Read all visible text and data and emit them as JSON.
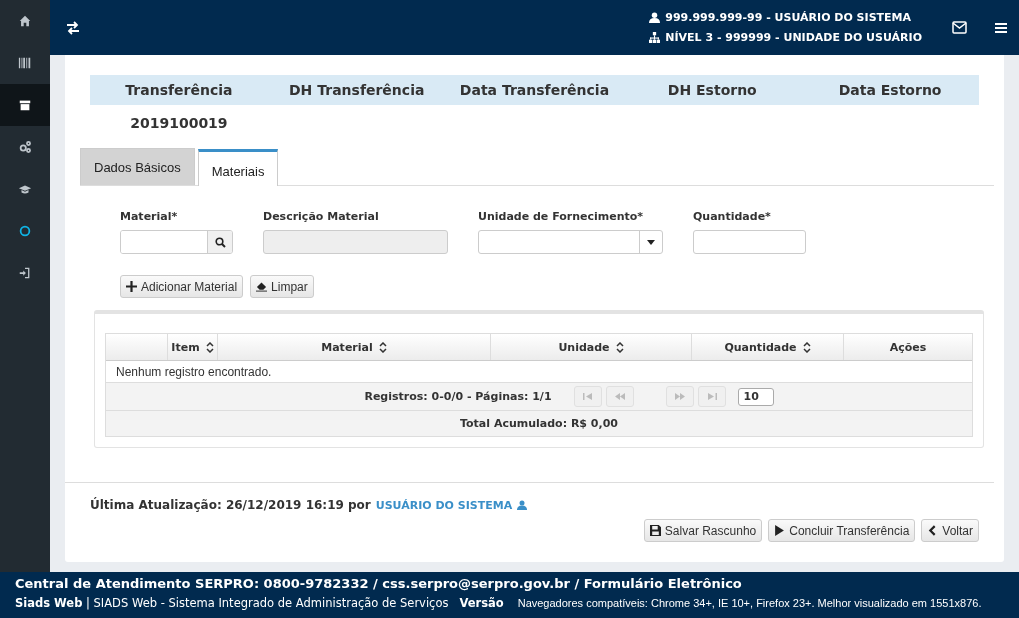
{
  "sidebar": {
    "items": [
      {
        "selected": false
      },
      {
        "selected": false
      },
      {
        "selected": true
      },
      {
        "selected": false
      },
      {
        "selected": false
      },
      {
        "selected": false
      },
      {
        "selected": false
      }
    ]
  },
  "header": {
    "user": "999.999.999-99 - USUÁRIO DO SISTEMA",
    "unit": "NÍVEL 3 - 999999 - UNIDADE DO USUÁRIO"
  },
  "summary": {
    "columns": [
      "Transferência",
      "DH Transferência",
      "Data Transferência",
      "DH Estorno",
      "Data Estorno"
    ],
    "values": [
      "2019100019"
    ]
  },
  "tabs": [
    {
      "label": "Dados Básicos",
      "selected": false
    },
    {
      "label": "Materiais",
      "selected": true
    }
  ],
  "form": {
    "fields": [
      {
        "label": "Material*",
        "kind": "search"
      },
      {
        "label": "Descrição Material",
        "kind": "disabled"
      },
      {
        "label": "Unidade de Fornecimento*",
        "kind": "select"
      },
      {
        "label": "Quantidade*",
        "kind": "text"
      }
    ],
    "buttons": [
      {
        "label": "Adicionar Material",
        "kind": "add"
      },
      {
        "label": "Limpar",
        "kind": "clear"
      }
    ]
  },
  "table": {
    "columns": [
      {
        "label": "Item",
        "sortable": true
      },
      {
        "label": "Material",
        "sortable": true
      },
      {
        "label": "Unidade",
        "sortable": true
      },
      {
        "label": "Quantidade",
        "sortable": true
      },
      {
        "label": "Ações",
        "sortable": false
      }
    ],
    "empty_message": "Nenhum registro encontrado.",
    "paginator": "Registros: 0-0/0 - Páginas: 1/1",
    "rows_per_page": "10",
    "total": "Total Acumulado: R$ 0,00"
  },
  "last_update": {
    "text": "Última Atualização: 26/12/2019 16:19 por",
    "user": "USUÁRIO DO SISTEMA"
  },
  "actions": [
    {
      "label": "Salvar Rascunho",
      "kind": "save"
    },
    {
      "label": "Concluir Transferência",
      "kind": "play"
    },
    {
      "label": "Voltar",
      "kind": "back"
    }
  ],
  "footer": {
    "contact": "Central de Atendimento SERPRO: 0800-9782332 / css.serpro@serpro.gov.br / Formulário Eletrônico",
    "brand": "Siads Web",
    "separator": "|",
    "system": "SIADS Web - Sistema Integrado de Administração de Serviços",
    "version": "Versão",
    "browsers": "Navegadores compatíveis: Chrome 34+, IE 10+, Firefox 23+. Melhor visualizado em 1551x876."
  }
}
